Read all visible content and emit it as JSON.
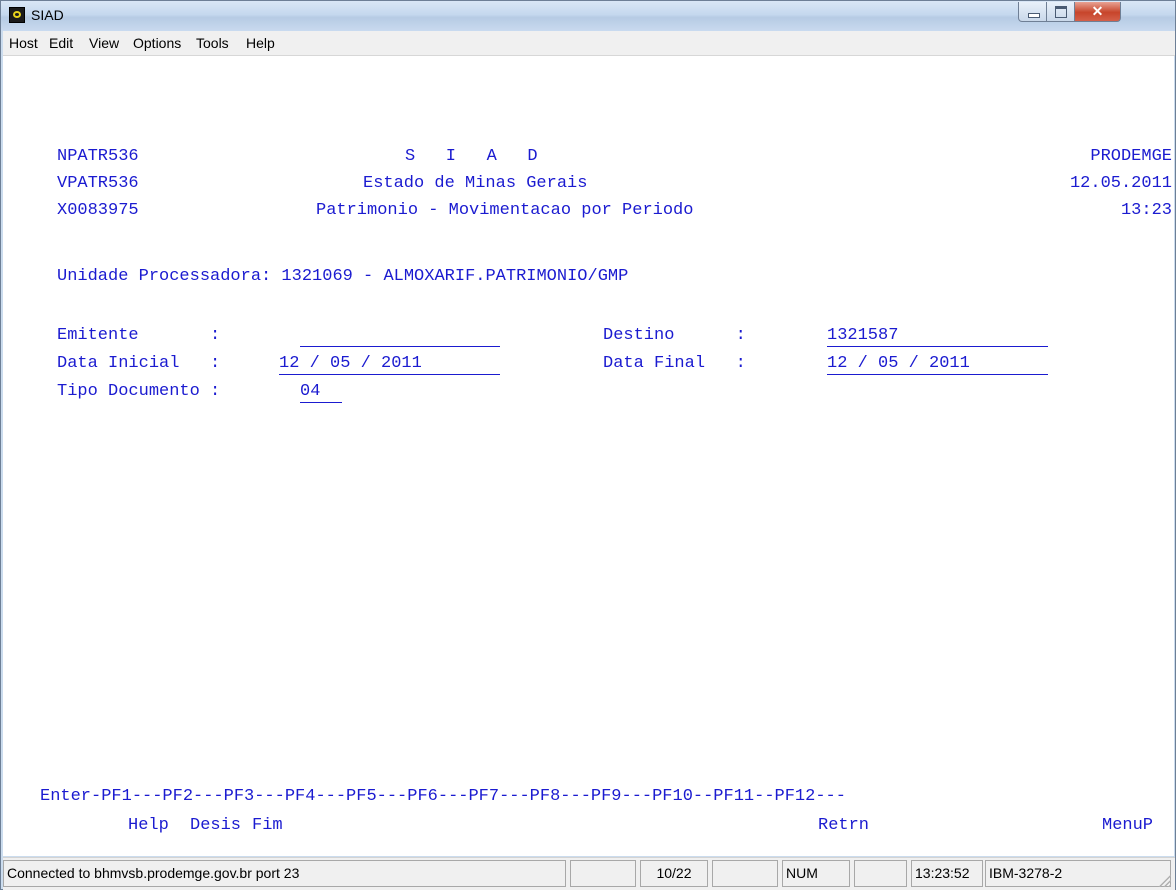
{
  "window": {
    "title": "SIAD"
  },
  "menu": [
    "Host",
    "Edit",
    "View",
    "Options",
    "Tools",
    "Help"
  ],
  "header": {
    "left": [
      "NPATR536",
      "VPATR536",
      "X0083975"
    ],
    "center": [
      "S   I   A   D",
      "Estado de Minas Gerais",
      "Patrimonio - Movimentacao por Periodo"
    ],
    "right": [
      "PRODEMGE",
      "12.05.2011",
      "13:23"
    ]
  },
  "unidade": "Unidade Processadora: 1321069 - ALMOXARIF.PATRIMONIO/GMP",
  "form": {
    "emitente_label": "Emitente       :",
    "emitente_value": "",
    "destino_label": "Destino      :",
    "destino_value": "1321587",
    "data_inicial_label": "Data Inicial   :",
    "data_inicial_value": "12 / 05 / 2011",
    "data_final_label": "Data Final   :",
    "data_final_value": "12 / 05 / 2011",
    "tipo_label": "Tipo Documento :",
    "tipo_value": "04"
  },
  "pfkeys_line": "Enter-PF1---PF2---PF3---PF4---PF5---PF6---PF7---PF8---PF9---PF10--PF11--PF12---",
  "pfkeys_labels": {
    "pf1": "Help",
    "pf2": "Desis",
    "pf3": "Fim",
    "pf9": "Retrn",
    "pf12": "MenuP"
  },
  "status": {
    "connection": "Connected to bhmvsb.prodemge.gov.br port 23",
    "cursor": "10/22",
    "num": "NUM",
    "time": "13:23:52",
    "terminal": "IBM-3278-2"
  }
}
